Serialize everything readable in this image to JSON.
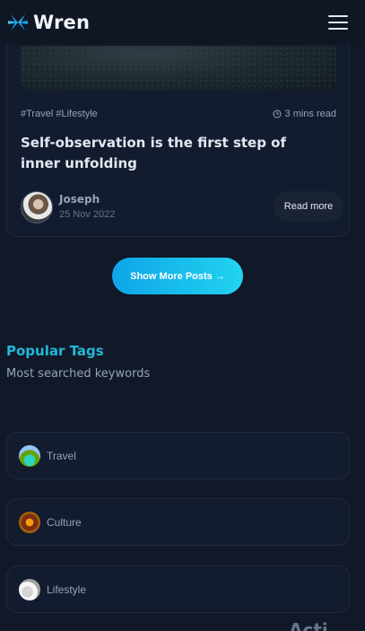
{
  "header": {
    "brand": "Wren",
    "accent": "#1d9bf0",
    "menu_icon": "hamburger-icon"
  },
  "post": {
    "tags": "#Travel #Lifestyle",
    "read_time": "3 mins read",
    "title": "Self-observation is the first step of inner unfolding",
    "author": "Joseph",
    "date": "25 Nov 2022",
    "read_more": "Read more"
  },
  "show_more": "Show More Posts →",
  "popular": {
    "title": "Popular Tags",
    "subtitle": "Most searched keywords",
    "items": [
      {
        "label": "Travel"
      },
      {
        "label": "Culture"
      },
      {
        "label": "Lifestyle"
      }
    ]
  },
  "cut_text": "Acti"
}
